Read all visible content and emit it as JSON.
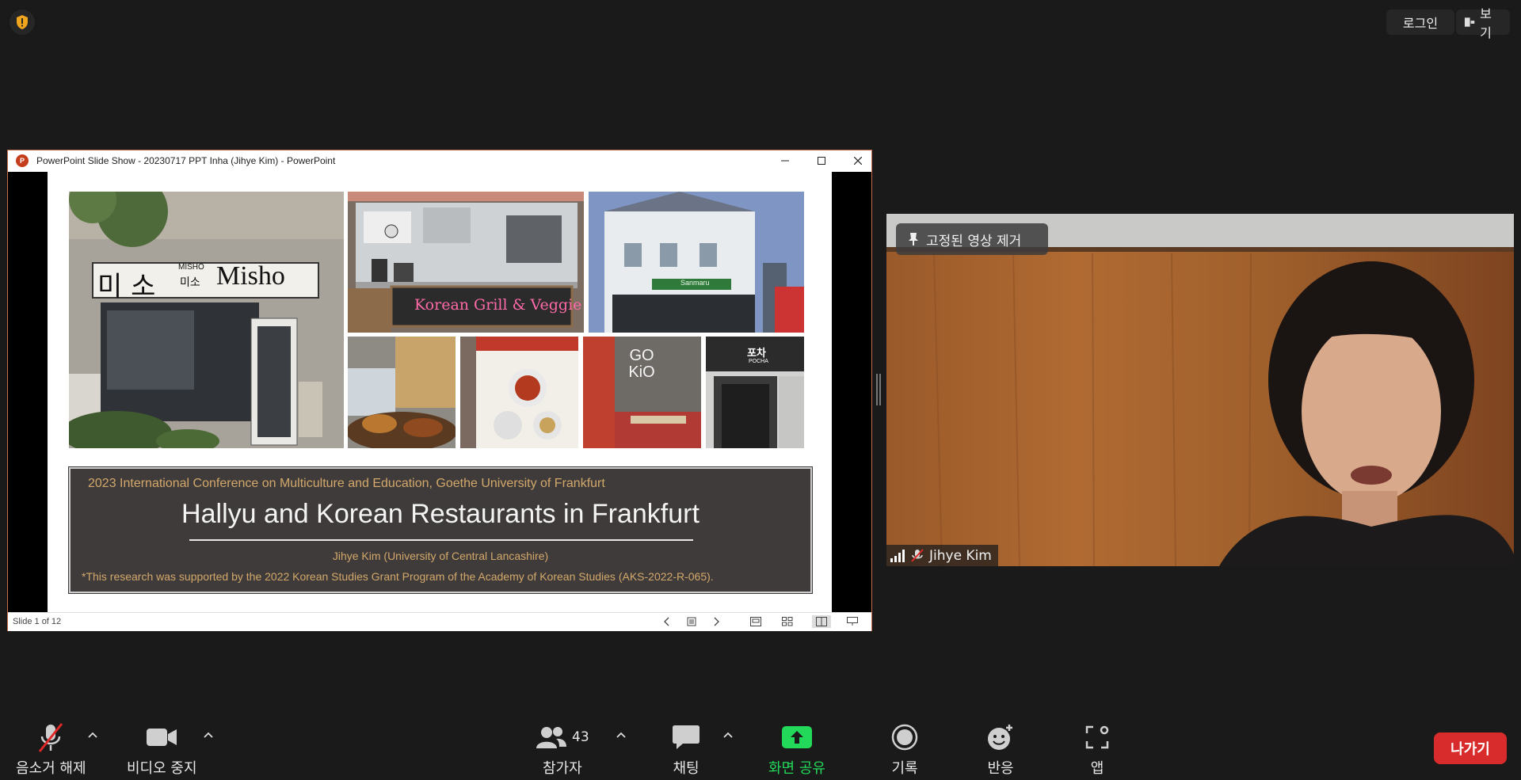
{
  "top_bar": {
    "shield_icon": "shield-alert-icon",
    "login_label": "로그인",
    "view_label": "보기"
  },
  "ppt_window": {
    "title": "PowerPoint Slide Show  -  20230717 PPT Inha (Jihye Kim) - PowerPoint",
    "logo_letter": "P",
    "status": "Slide 1 of 12"
  },
  "slide": {
    "photo_texts": {
      "misho_korean": "미 소",
      "misho_small_en": "MISHO",
      "misho_small_ko": "미소",
      "misho_en": "Misho",
      "grill_sign": "Korean Grill & Veggie",
      "sanmaru_sign": "Sanmaru",
      "gokio_sign": "GO KiO",
      "pocha_ko": "포차",
      "pocha_en": "POCHA"
    },
    "conference": "2023 International Conference on Multiculture and Education, Goethe University of Frankfurt",
    "title": "Hallyu and Korean Restaurants in Frankfurt",
    "author": "Jihye Kim (University of Central Lancashire)",
    "support": "*This research was supported by the 2022 Korean Studies Grant Program of the Academy of Korean Studies (AKS-2022-R-065)."
  },
  "video": {
    "pin_label": "고정된 영상 제거",
    "participant_name": "Jihye Kim"
  },
  "toolbar": {
    "unmute": "음소거 해제",
    "stop_video": "비디오 중지",
    "participants": "참가자",
    "participants_count": "43",
    "chat": "채팅",
    "share_screen": "화면 공유",
    "record": "기록",
    "reactions": "반응",
    "apps": "앱",
    "leave": "나가기"
  },
  "colors": {
    "background": "#1a1a1a",
    "share_green": "#23d959",
    "leave_red": "#d82b2b",
    "slide_text_gold": "#d2a86a",
    "title_box": "#403b3b"
  }
}
